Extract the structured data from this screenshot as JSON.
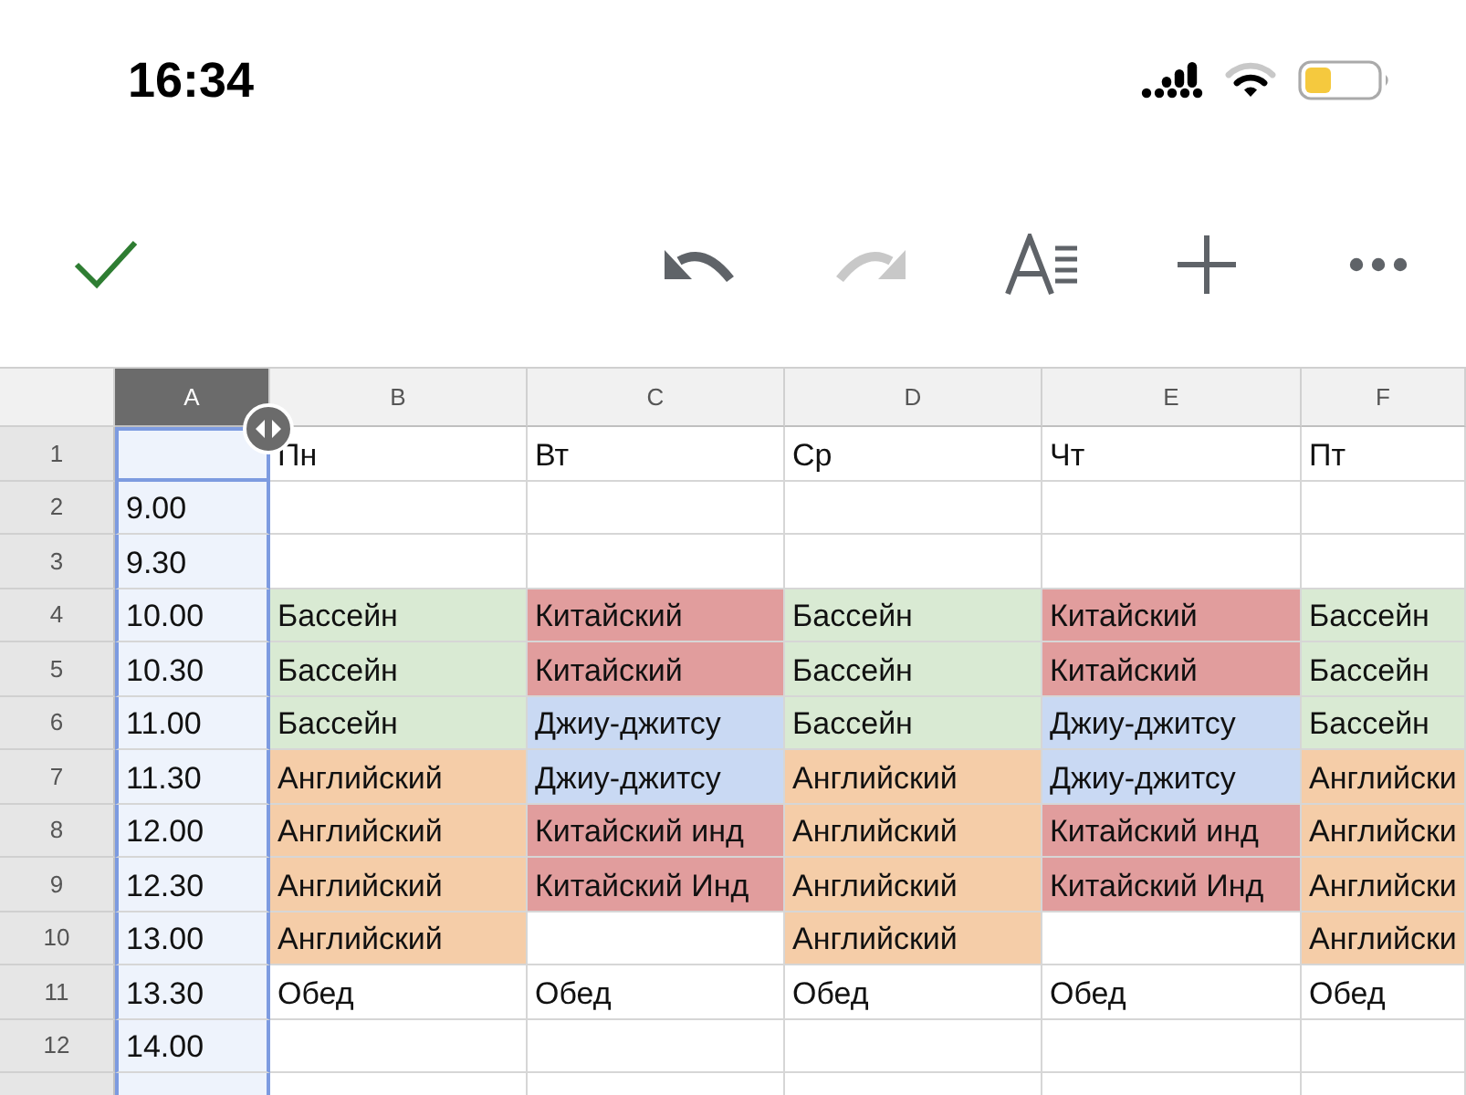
{
  "status_bar": {
    "time": "16:34"
  },
  "toolbar": [
    {
      "kind": "done",
      "disabled": false
    },
    {
      "kind": "undo",
      "disabled": false
    },
    {
      "kind": "redo",
      "disabled": true
    },
    {
      "kind": "format",
      "disabled": false
    },
    {
      "kind": "insert",
      "disabled": false
    },
    {
      "kind": "more",
      "disabled": false
    }
  ],
  "columns": [
    {
      "label": "A",
      "selected": true
    },
    {
      "label": "B",
      "selected": false
    },
    {
      "label": "C",
      "selected": false
    },
    {
      "label": "D",
      "selected": false
    },
    {
      "label": "E",
      "selected": false
    },
    {
      "label": "F",
      "selected": false
    }
  ],
  "rows": [
    {
      "label": "1",
      "cells": [
        {},
        {
          "text": "Пн"
        },
        {
          "text": "Вт"
        },
        {
          "text": "Ср"
        },
        {
          "text": "Чт"
        },
        {
          "text": "Пт"
        }
      ]
    },
    {
      "label": "2",
      "cells": [
        {
          "text": "9.00"
        },
        {},
        {},
        {},
        {},
        {}
      ]
    },
    {
      "label": "3",
      "cells": [
        {
          "text": "9.30"
        },
        {},
        {},
        {},
        {},
        {}
      ]
    },
    {
      "label": "4",
      "cells": [
        {
          "text": "10.00"
        },
        {
          "text": "Бассейн",
          "color": "#d9ead3"
        },
        {
          "text": "Китайский",
          "color": "#e19d9d"
        },
        {
          "text": "Бассейн",
          "color": "#d9ead3"
        },
        {
          "text": "Китайский",
          "color": "#e19d9d"
        },
        {
          "text": "Бассейн",
          "color": "#d9ead3"
        }
      ]
    },
    {
      "label": "5",
      "cells": [
        {
          "text": "10.30"
        },
        {
          "text": "Бассейн",
          "color": "#d9ead3"
        },
        {
          "text": "Китайский",
          "color": "#e19d9d"
        },
        {
          "text": "Бассейн",
          "color": "#d9ead3"
        },
        {
          "text": "Китайский",
          "color": "#e19d9d"
        },
        {
          "text": "Бассейн",
          "color": "#d9ead3"
        }
      ]
    },
    {
      "label": "6",
      "cells": [
        {
          "text": "11.00"
        },
        {
          "text": "Бассейн",
          "color": "#d9ead3"
        },
        {
          "text": "Джиу-джитсу",
          "color": "#c9d9f3"
        },
        {
          "text": "Бассейн",
          "color": "#d9ead3"
        },
        {
          "text": "Джиу-джитсу",
          "color": "#c9d9f3"
        },
        {
          "text": "Бассейн",
          "color": "#d9ead3"
        }
      ]
    },
    {
      "label": "7",
      "cells": [
        {
          "text": "11.30"
        },
        {
          "text": "Английский",
          "color": "#f5cda8"
        },
        {
          "text": "Джиу-джитсу",
          "color": "#c9d9f3"
        },
        {
          "text": "Английский",
          "color": "#f5cda8"
        },
        {
          "text": "Джиу-джитсу",
          "color": "#c9d9f3"
        },
        {
          "text": "Английски",
          "color": "#f5cda8"
        }
      ]
    },
    {
      "label": "8",
      "cells": [
        {
          "text": "12.00"
        },
        {
          "text": "Английский",
          "color": "#f5cda8"
        },
        {
          "text": "Китайский инд",
          "color": "#e19d9d"
        },
        {
          "text": "Английский",
          "color": "#f5cda8"
        },
        {
          "text": "Китайский инд",
          "color": "#e19d9d"
        },
        {
          "text": "Английски",
          "color": "#f5cda8"
        }
      ]
    },
    {
      "label": "9",
      "cells": [
        {
          "text": "12.30"
        },
        {
          "text": "Английский",
          "color": "#f5cda8"
        },
        {
          "text": "Китайский Инд",
          "color": "#e19d9d"
        },
        {
          "text": "Английский",
          "color": "#f5cda8"
        },
        {
          "text": "Китайский Инд",
          "color": "#e19d9d"
        },
        {
          "text": "Английски",
          "color": "#f5cda8"
        }
      ]
    },
    {
      "label": "10",
      "cells": [
        {
          "text": "13.00"
        },
        {
          "text": "Английский",
          "color": "#f5cda8"
        },
        {},
        {
          "text": "Английский",
          "color": "#f5cda8"
        },
        {},
        {
          "text": "Английски",
          "color": "#f5cda8"
        }
      ]
    },
    {
      "label": "11",
      "cells": [
        {
          "text": "13.30"
        },
        {
          "text": "Обед"
        },
        {
          "text": "Обед"
        },
        {
          "text": "Обед"
        },
        {
          "text": "Обед"
        },
        {
          "text": "Обед"
        }
      ]
    },
    {
      "label": "12",
      "cells": [
        {
          "text": "14.00"
        },
        {},
        {},
        {},
        {},
        {}
      ]
    },
    {
      "cells": [
        {},
        {},
        {},
        {},
        {},
        {}
      ]
    }
  ]
}
